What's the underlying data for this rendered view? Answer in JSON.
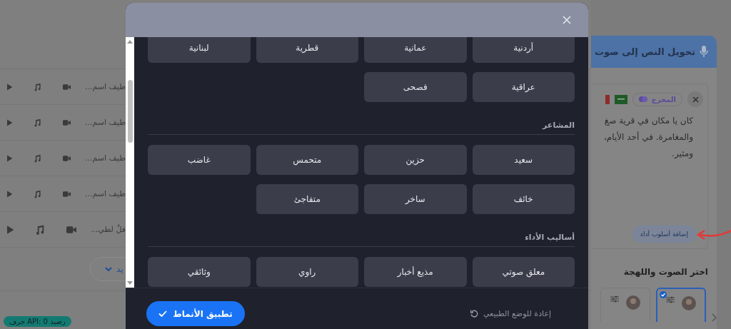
{
  "background": {
    "rows": [
      {
        "title": "طيف اسم..."
      },
      {
        "title": "طيف اسم..."
      },
      {
        "title": "طيف اسم..."
      },
      {
        "title": "طيف اسم..."
      },
      {
        "title": "فلٌ لطي..."
      }
    ],
    "more_button": "يد",
    "credit_badge": "رصيد API: 0 حرف",
    "panel": {
      "title": "تحويل النص إلى صوت",
      "director_chip": "المخرج",
      "text_lines": [
        "كان يا مكان في قرية صغ",
        "والمغامرة. في أحد الأيام،",
        "ومثير."
      ],
      "add_style_button": "إضافة أسلوب أداء",
      "voice_heading": "اختر الصوت واللهجة",
      "voices": [
        {
          "selected": true
        },
        {
          "selected": false
        }
      ]
    }
  },
  "modal": {
    "sections": [
      {
        "options": [
          {
            "label": "أردنية",
            "selected": false
          },
          {
            "label": "عمانية",
            "selected": false
          },
          {
            "label": "قطرية",
            "selected": false
          },
          {
            "label": "لبنانية",
            "selected": false
          },
          {
            "label": "عراقية",
            "selected": false
          },
          {
            "label": "فصحى",
            "selected": false
          }
        ]
      },
      {
        "heading": "المشاعر",
        "options": [
          {
            "label": "سعيد",
            "selected": false
          },
          {
            "label": "حزين",
            "selected": false
          },
          {
            "label": "متحمس",
            "selected": false
          },
          {
            "label": "غاضب",
            "selected": false
          },
          {
            "label": "خائف",
            "selected": false
          },
          {
            "label": "ساخر",
            "selected": false
          },
          {
            "label": "متفاجئ",
            "selected": false
          }
        ]
      },
      {
        "heading": "أساليب الأداء",
        "options": [
          {
            "label": "معلق صوتي",
            "selected": false
          },
          {
            "label": "مذيع أخبار",
            "selected": false
          },
          {
            "label": "راوي",
            "selected": false
          },
          {
            "label": "وثائقي",
            "selected": false
          }
        ]
      }
    ],
    "reset_button": "إعادة للوضع الطبيعي",
    "apply_button": "تطبيق الأنماط"
  }
}
